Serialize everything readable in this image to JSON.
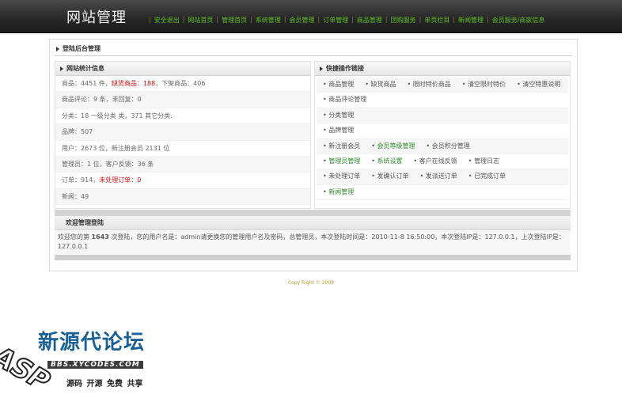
{
  "header": {
    "title": "网站管理",
    "nav": [
      "安全退出",
      "网站首页",
      "管理首页",
      "系统管理",
      "会员管理",
      "订单管理",
      "商品管理",
      "团购服务",
      "单页栏目",
      "新闻管理",
      "会员服务/商家信息"
    ]
  },
  "breadcrumb": "登陆后台管理",
  "stats": {
    "heading": "网站统计信息",
    "rows": [
      {
        "a": "商品：4451 件，",
        "b": "缺货商品：188",
        "c": "，下架商品：406"
      },
      {
        "a": "商品评论：9 条，未回复：0",
        "b": "",
        "c": ""
      },
      {
        "a": "分类：18 一级分类 类，371 其它分类.",
        "b": "",
        "c": ""
      },
      {
        "a": "品牌：507",
        "b": "",
        "c": ""
      },
      {
        "a": "用户：2673 位，新注册会员  2131 位",
        "b": "",
        "c": ""
      },
      {
        "a": "管理员：1  位，客户反馈：36 条",
        "b": "",
        "c": ""
      },
      {
        "a": "订单：914，",
        "b": "未处理订单：0",
        "c": ""
      },
      {
        "a": "新闻：49",
        "b": "",
        "c": ""
      }
    ]
  },
  "quick": {
    "heading": "快捷操作链接",
    "rows": [
      [
        "商品管理",
        "缺货商品",
        "限时特价商品",
        "清空限时特价",
        "清空特惠说明"
      ],
      [
        "商品评论管理"
      ],
      [
        "分类管理"
      ],
      [
        "品牌管理"
      ],
      [
        "新注册会员",
        "会员等级管理",
        "会员积分管理"
      ],
      [
        "管理员管理",
        "系统设置",
        "客户在线反馈",
        "管理日志"
      ],
      [
        "未处理订单",
        "发确认订单",
        "发派送订单",
        "已完成订单"
      ],
      [
        "新闻管理"
      ]
    ]
  },
  "welcome": {
    "heading": "欢迎管理登陆",
    "text_before": "欢迎您的第 ",
    "count": "1643",
    "text_after": " 次登陆，您的用户名是：admin请更换您的管理用户名及密码，总管理员，本次登陆时间是：2010-11-8 16:50:00，本次登陆IP是：127.0.0.1，上次登陆IP是：127.0.0.1"
  },
  "footer": {
    "copyright": "Copy Right © 2008"
  },
  "watermark": {
    "asp": "ASP",
    "title": "新源代论坛",
    "url": "BBS.XYCODES.COM",
    "slogan": "源码 开源 免费 共享"
  },
  "colors": {
    "nav_text": "#5fc02b",
    "highlight": "#cc1111",
    "link_green": "#2f8a2f"
  }
}
